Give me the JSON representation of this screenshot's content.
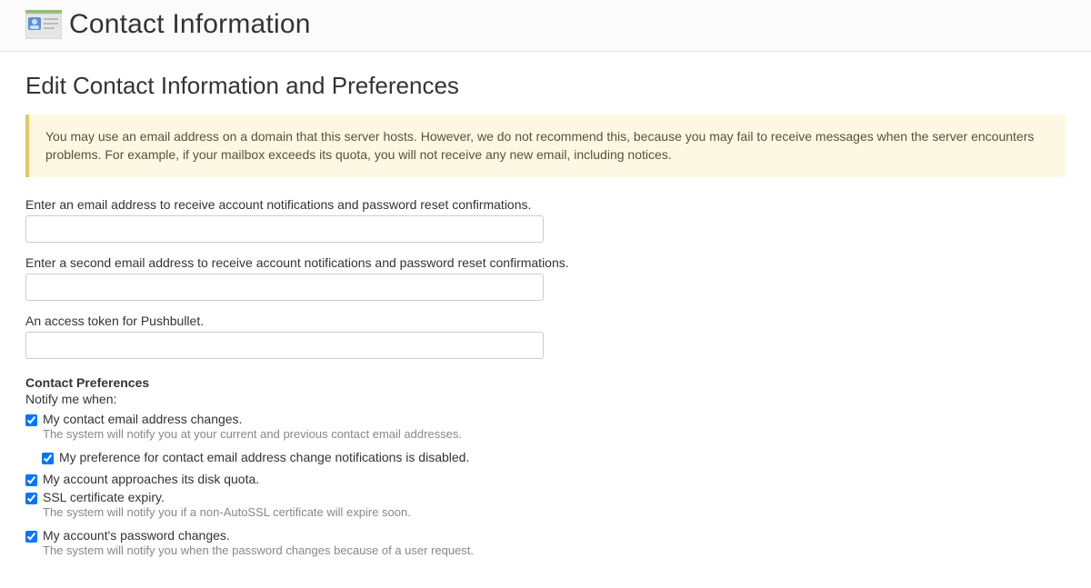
{
  "header": {
    "title": "Contact Information"
  },
  "subheader": "Edit Contact Information and Preferences",
  "notice": "You may use an email address on a domain that this server hosts. However, we do not recommend this, because you may fail to receive messages when the server encounters problems. For example, if your mailbox exceeds its quota, you will not receive any new email, including notices.",
  "fields": {
    "primary_email": {
      "label": "Enter an email address to receive account notifications and password reset confirmations.",
      "value": ""
    },
    "secondary_email": {
      "label": "Enter a second email address to receive account notifications and password reset confirmations.",
      "value": ""
    },
    "pushbullet_token": {
      "label": "An access token for Pushbullet.",
      "value": ""
    }
  },
  "preferences": {
    "heading": "Contact Preferences",
    "intro": "Notify me when:",
    "items": [
      {
        "label": "My contact email address changes.",
        "help": "The system will notify you at your current and previous contact email addresses.",
        "checked": true,
        "sub": {
          "label": "My preference for contact email address change notifications is disabled.",
          "checked": true
        }
      },
      {
        "label": "My account approaches its disk quota.",
        "checked": true
      },
      {
        "label": "SSL certificate expiry.",
        "help": "The system will notify you if a non-AutoSSL certificate will expire soon.",
        "checked": true
      },
      {
        "label": "My account's password changes.",
        "help": "The system will notify you when the password changes because of a user request.",
        "checked": true
      }
    ]
  }
}
